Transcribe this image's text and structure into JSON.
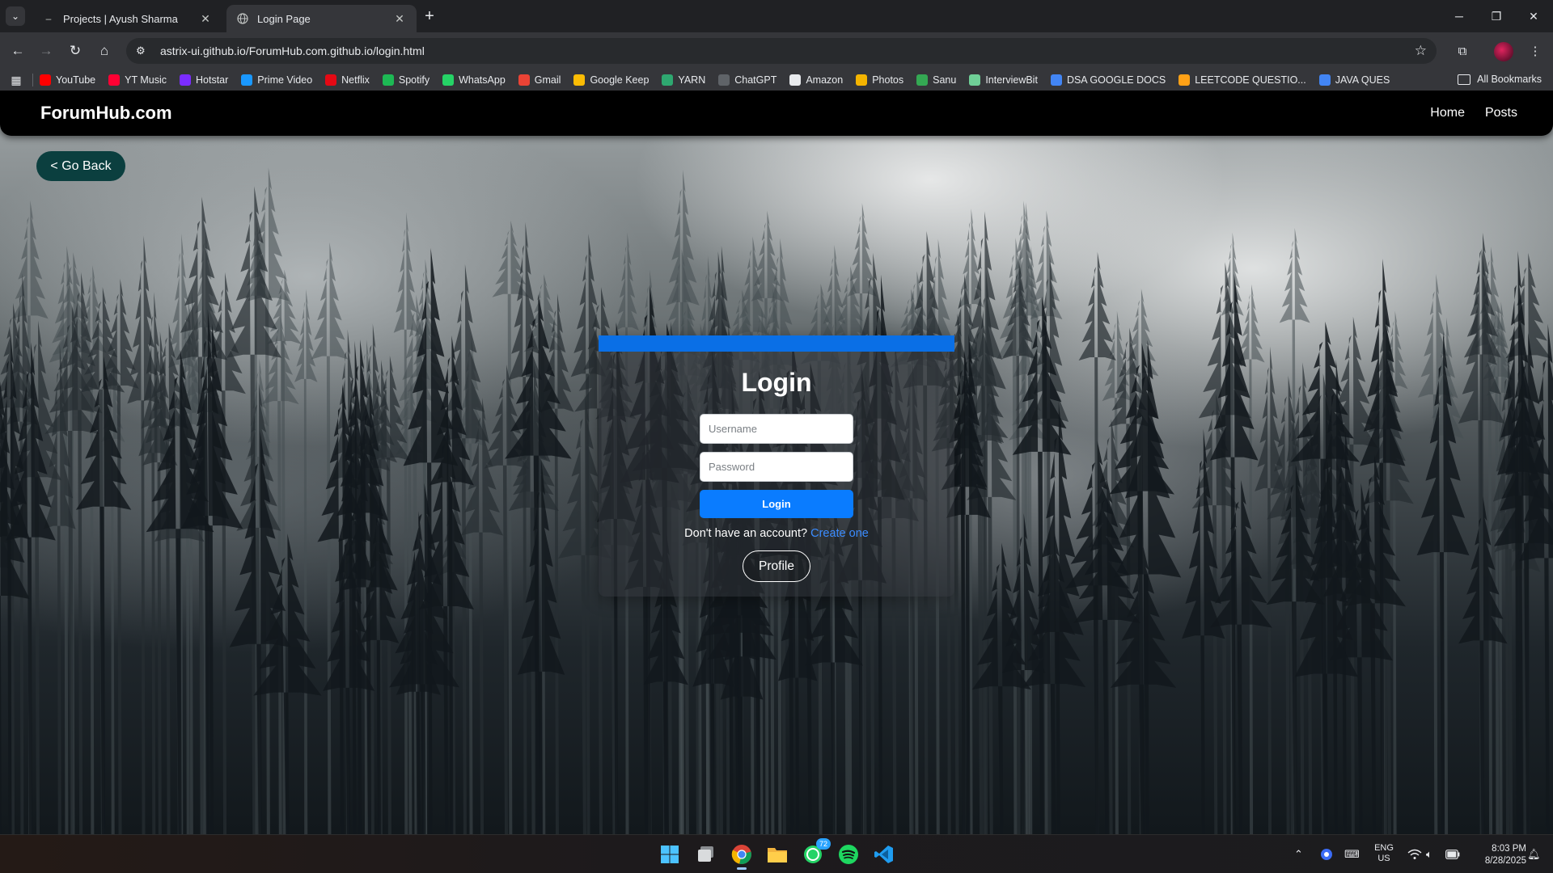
{
  "browser": {
    "tabs": [
      {
        "title": "Projects | Ayush Sharma",
        "active": false
      },
      {
        "title": "Login Page",
        "active": true
      }
    ],
    "url": "astrix-ui.github.io/ForumHub.com.github.io/login.html",
    "bookmarks": [
      {
        "label": "YouTube",
        "icon": "youtube-icon",
        "color": "#ff0000"
      },
      {
        "label": "YT Music",
        "icon": "yt-music-icon",
        "color": "#ff0033"
      },
      {
        "label": "Hotstar",
        "icon": "hotstar-icon",
        "color": "#7b2cff"
      },
      {
        "label": "Prime Video",
        "icon": "prime-video-icon",
        "color": "#1a98ff"
      },
      {
        "label": "Netflix",
        "icon": "netflix-icon",
        "color": "#e50914"
      },
      {
        "label": "Spotify",
        "icon": "spotify-icon",
        "color": "#1db954"
      },
      {
        "label": "WhatsApp",
        "icon": "whatsapp-icon",
        "color": "#25d366"
      },
      {
        "label": "Gmail",
        "icon": "gmail-icon",
        "color": "#ea4335"
      },
      {
        "label": "Google Keep",
        "icon": "google-keep-icon",
        "color": "#fbbc04"
      },
      {
        "label": "YARN",
        "icon": "yarn-icon",
        "color": "#2ea870"
      },
      {
        "label": "ChatGPT",
        "icon": "chatgpt-icon",
        "color": "#5f6368"
      },
      {
        "label": "Amazon",
        "icon": "amazon-icon",
        "color": "#e8eaed"
      },
      {
        "label": "Photos",
        "icon": "photos-icon",
        "color": "#f4b400"
      },
      {
        "label": "Sanu",
        "icon": "sanu-icon",
        "color": "#34a853"
      },
      {
        "label": "InterviewBit",
        "icon": "interviewbit-icon",
        "color": "#6fcf97"
      },
      {
        "label": "DSA GOOGLE DOCS",
        "icon": "google-docs-icon",
        "color": "#4285f4"
      },
      {
        "label": "LEETCODE QUESTIO...",
        "icon": "leetcode-icon",
        "color": "#ffa116"
      },
      {
        "label": "JAVA QUES",
        "icon": "google-docs-icon",
        "color": "#4285f4"
      }
    ],
    "all_bookmarks": "All Bookmarks"
  },
  "site": {
    "logo": "ForumHub.com",
    "nav": [
      "Home",
      "Posts"
    ],
    "go_back": "< Go Back"
  },
  "login": {
    "title": "Login",
    "username_placeholder": "Username",
    "password_placeholder": "Password",
    "submit": "Login",
    "signup_prompt": "Don't have an account?",
    "signup_link": "Create one",
    "profile": "Profile",
    "accent_color": "#0a7cff"
  },
  "taskbar": {
    "whatsapp_badge": "72",
    "lang_line1": "ENG",
    "lang_line2": "US",
    "time": "8:03 PM",
    "date": "8/28/2025"
  }
}
